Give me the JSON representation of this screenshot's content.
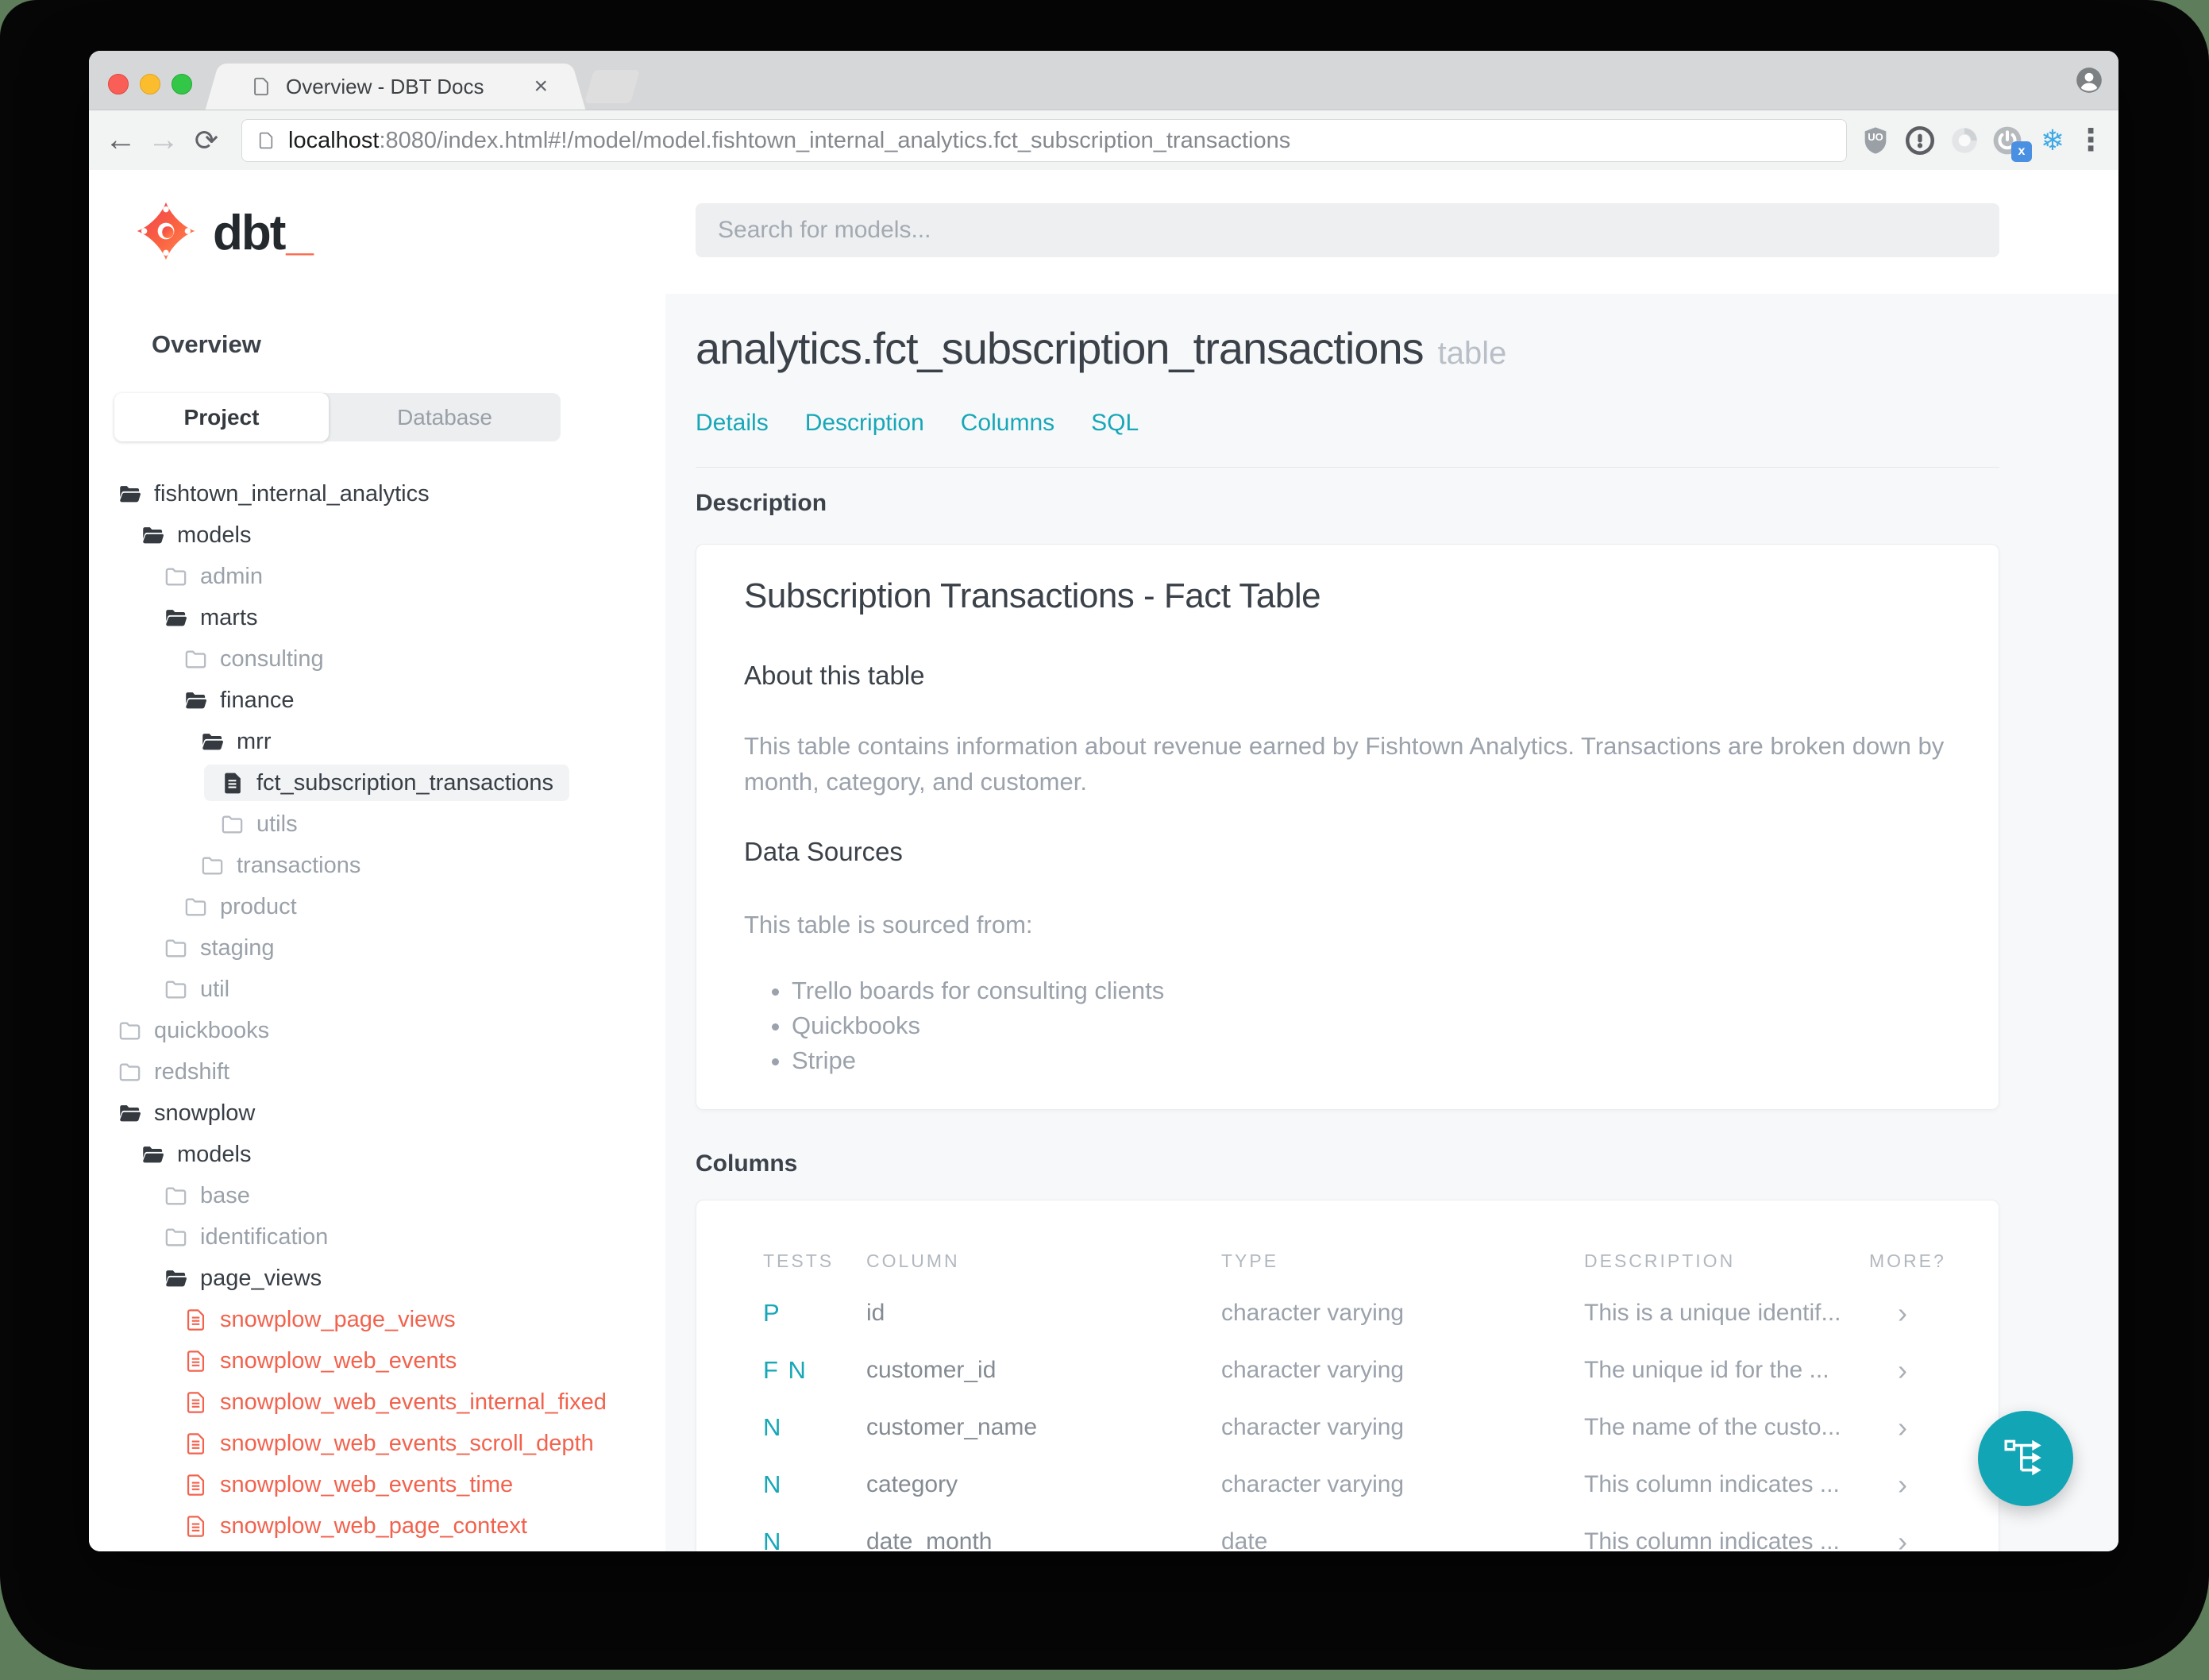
{
  "browser": {
    "tab_title": "Overview - DBT Docs",
    "url_host": "localhost",
    "url_rest": ":8080/index.html#!/model/model.fishtown_internal_analytics.fct_subscription_transactions",
    "ublock_label": "UO",
    "extension_badge": "x"
  },
  "icons": {
    "back": "←",
    "forward": "→",
    "refresh": "⟳",
    "close_tab": "×",
    "dots": "⋮",
    "snowflake": "❄",
    "chevron": "›"
  },
  "header": {
    "logo_text": "dbt",
    "logo_underscore": "_",
    "search_placeholder": "Search for models..."
  },
  "sidebar": {
    "title": "Overview",
    "tabs": [
      {
        "label": "Project",
        "active": true
      },
      {
        "label": "Database",
        "active": false
      }
    ],
    "tree": [
      {
        "label": "fishtown_internal_analytics",
        "level": 0,
        "icon": "folder-open",
        "tone": "dark"
      },
      {
        "label": "models",
        "level": 1,
        "icon": "folder-open",
        "tone": "dark"
      },
      {
        "label": "admin",
        "level": 2,
        "icon": "folder",
        "tone": "muted"
      },
      {
        "label": "marts",
        "level": 2,
        "icon": "folder-open",
        "tone": "dark"
      },
      {
        "label": "consulting",
        "level": 3,
        "icon": "folder",
        "tone": "muted"
      },
      {
        "label": "finance",
        "level": 3,
        "icon": "folder-open",
        "tone": "dark"
      },
      {
        "label": "mrr",
        "level": 4,
        "icon": "folder-open",
        "tone": "dark"
      },
      {
        "label": "fct_subscription_transactions",
        "level": 5,
        "icon": "file-solid",
        "tone": "dark",
        "selected": true
      },
      {
        "label": "utils",
        "level": 5,
        "icon": "folder",
        "tone": "muted"
      },
      {
        "label": "transactions",
        "level": 4,
        "icon": "folder",
        "tone": "muted"
      },
      {
        "label": "product",
        "level": 3,
        "icon": "folder",
        "tone": "muted"
      },
      {
        "label": "staging",
        "level": 2,
        "icon": "folder",
        "tone": "muted"
      },
      {
        "label": "util",
        "level": 2,
        "icon": "folder",
        "tone": "muted"
      },
      {
        "label": "quickbooks",
        "level": 0,
        "icon": "folder",
        "tone": "muted"
      },
      {
        "label": "redshift",
        "level": 0,
        "icon": "folder",
        "tone": "muted"
      },
      {
        "label": "snowplow",
        "level": 0,
        "icon": "folder-open",
        "tone": "dark"
      },
      {
        "label": "models",
        "level": 1,
        "icon": "folder-open",
        "tone": "dark"
      },
      {
        "label": "base",
        "level": 2,
        "icon": "folder",
        "tone": "muted"
      },
      {
        "label": "identification",
        "level": 2,
        "icon": "folder",
        "tone": "muted"
      },
      {
        "label": "page_views",
        "level": 2,
        "icon": "folder-open",
        "tone": "dark"
      },
      {
        "label": "snowplow_page_views",
        "level": 3,
        "icon": "file",
        "tone": "red"
      },
      {
        "label": "snowplow_web_events",
        "level": 3,
        "icon": "file",
        "tone": "red"
      },
      {
        "label": "snowplow_web_events_internal_fixed",
        "level": 3,
        "icon": "file",
        "tone": "red"
      },
      {
        "label": "snowplow_web_events_scroll_depth",
        "level": 3,
        "icon": "file",
        "tone": "red"
      },
      {
        "label": "snowplow_web_events_time",
        "level": 3,
        "icon": "file",
        "tone": "red"
      },
      {
        "label": "snowplow_web_page_context",
        "level": 3,
        "icon": "file",
        "tone": "red"
      }
    ]
  },
  "main": {
    "title": "analytics.fct_subscription_transactions",
    "title_suffix": "table",
    "nav": [
      "Details",
      "Description",
      "Columns",
      "SQL"
    ],
    "description_section": {
      "label": "Description",
      "heading": "Subscription Transactions - Fact Table",
      "about_heading": "About this table",
      "about_text": "This table contains information about revenue earned by Fishtown Analytics. Transactions are broken down by month, category, and customer.",
      "sources_heading": "Data Sources",
      "sources_intro": "This table is sourced from:",
      "sources": [
        "Trello boards for consulting clients",
        "Quickbooks",
        "Stripe"
      ]
    },
    "columns_section": {
      "label": "Columns",
      "headers": [
        "TESTS",
        "COLUMN",
        "TYPE",
        "DESCRIPTION",
        "MORE?"
      ],
      "rows": [
        {
          "tests": "P",
          "column": "id",
          "type": "character varying",
          "description": "This is a unique identif..."
        },
        {
          "tests": "F N",
          "column": "customer_id",
          "type": "character varying",
          "description": "The unique id for the ..."
        },
        {
          "tests": "N",
          "column": "customer_name",
          "type": "character varying",
          "description": "The name of the custo..."
        },
        {
          "tests": "N",
          "column": "category",
          "type": "character varying",
          "description": "This column indicates ..."
        },
        {
          "tests": "N",
          "column": "date_month",
          "type": "date",
          "description": "This column indicates ..."
        }
      ]
    }
  },
  "fab": {
    "icon": "lineage-graph"
  },
  "colors": {
    "accent_teal": "#17a7b7",
    "accent_red": "#f2624d",
    "fab": "#12a5b5"
  }
}
